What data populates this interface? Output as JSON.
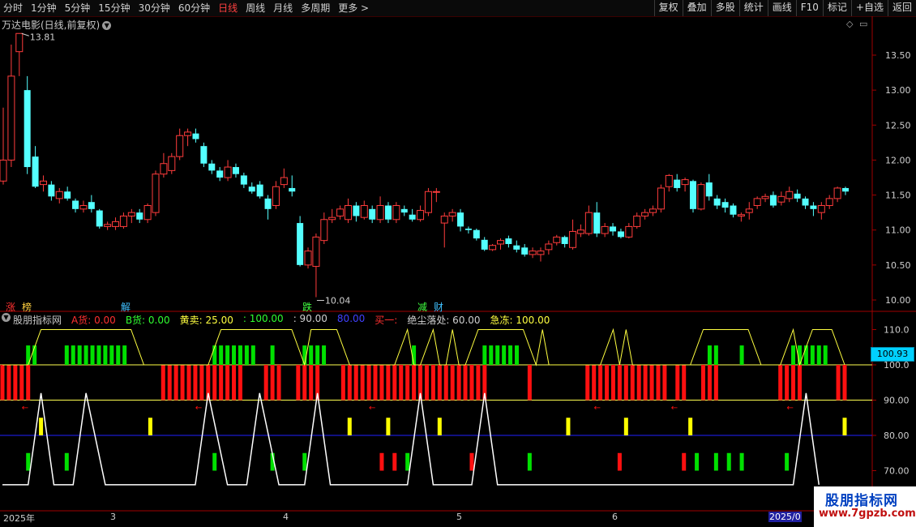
{
  "toolbar": {
    "periods": [
      "分时",
      "1分钟",
      "5分钟",
      "15分钟",
      "30分钟",
      "60分钟",
      "日线",
      "周线",
      "月线",
      "多周期",
      "更多 >"
    ],
    "active_period": "日线",
    "buttons": [
      "复权",
      "叠加",
      "多股",
      "统计",
      "画线",
      "F10",
      "标记",
      "+自选",
      "返回"
    ]
  },
  "stock": {
    "title": "万达电影(日线,前复权)",
    "high_label": "13.81",
    "low_label": "10.04"
  },
  "price_axis": [
    "13.50",
    "13.00",
    "12.50",
    "12.00",
    "11.50",
    "11.00",
    "10.50",
    "10.00"
  ],
  "indicator_axis": [
    "110.0",
    "100.0",
    "90.00",
    "80.00",
    "70.00"
  ],
  "current_value_tag": "100.93",
  "events": [
    {
      "text": "涨",
      "color": "#ff3030"
    },
    {
      "text": "榜",
      "color": "#ffd040"
    },
    {
      "text": "解",
      "color": "#40c0ff"
    },
    {
      "text": "跌",
      "color": "#40ff40"
    },
    {
      "text": "减",
      "color": "#40ff40"
    },
    {
      "text": "财",
      "color": "#40c0ff"
    }
  ],
  "indicator": {
    "name": "股朋指标网",
    "items": [
      {
        "text": "A货: 0.00",
        "color": "#ff3030"
      },
      {
        "text": "B货: 0.00",
        "color": "#30ff30"
      },
      {
        "text": "黄卖: 25.00",
        "color": "#ffff40"
      },
      {
        "text": ": 100.00",
        "color": "#30ff30"
      },
      {
        "text": ": 90.00",
        "color": "#d0d0d0"
      },
      {
        "text": "80.00",
        "color": "#4040ff"
      },
      {
        "text": "买一:",
        "color": "#ff3030"
      },
      {
        "text": "绝尘落处: 60.00",
        "color": "#d0d0d0"
      },
      {
        "text": "急冻: 100.00",
        "color": "#ffff40"
      }
    ]
  },
  "date_axis": [
    "2025年",
    "3",
    "4",
    "5",
    "6",
    "2025/0"
  ],
  "watermark": {
    "name": "股朋指标网",
    "url": "www.7gpzb.com"
  },
  "colors": {
    "up": "#ff3c3c",
    "down": "#54ffff",
    "axis": "#a00000",
    "green_bar": "#00e000",
    "red_bar": "#ff1010",
    "yellow_bar": "#ffff00",
    "line_80": "#2020ff"
  },
  "chart_data": {
    "type": "candlestick",
    "ylim": [
      9.9,
      13.9
    ],
    "candles": [
      [
        11.7,
        12.0,
        11.65,
        12.75
      ],
      [
        12.0,
        13.2,
        11.9,
        13.65
      ],
      [
        13.55,
        13.81,
        13.2,
        13.81
      ],
      [
        13.0,
        11.9,
        11.8,
        13.2
      ],
      [
        12.05,
        11.62,
        11.6,
        12.2
      ],
      [
        11.65,
        11.7,
        11.55,
        11.78
      ],
      [
        11.65,
        11.48,
        11.42,
        11.7
      ],
      [
        11.45,
        11.55,
        11.38,
        11.6
      ],
      [
        11.55,
        11.45,
        11.42,
        11.62
      ],
      [
        11.42,
        11.3,
        11.25,
        11.45
      ],
      [
        11.3,
        11.35,
        11.25,
        11.42
      ],
      [
        11.4,
        11.3,
        11.25,
        11.5
      ],
      [
        11.28,
        11.05,
        11.02,
        11.3
      ],
      [
        11.05,
        11.08,
        11.0,
        11.12
      ],
      [
        11.05,
        11.12,
        11.0,
        11.18
      ],
      [
        11.05,
        11.2,
        11.02,
        11.25
      ],
      [
        11.2,
        11.25,
        11.1,
        11.3
      ],
      [
        11.25,
        11.15,
        11.1,
        11.3
      ],
      [
        11.15,
        11.35,
        11.1,
        11.38
      ],
      [
        11.25,
        11.8,
        11.2,
        11.85
      ],
      [
        11.8,
        11.95,
        11.75,
        12.1
      ],
      [
        11.85,
        12.05,
        11.8,
        12.1
      ],
      [
        12.05,
        12.35,
        12.0,
        12.45
      ],
      [
        12.35,
        12.4,
        12.2,
        12.45
      ],
      [
        12.38,
        12.3,
        12.25,
        12.45
      ],
      [
        12.2,
        11.95,
        11.9,
        12.25
      ],
      [
        11.95,
        11.85,
        11.8,
        12.0
      ],
      [
        11.85,
        11.75,
        11.7,
        11.9
      ],
      [
        11.75,
        11.9,
        11.7,
        12.0
      ],
      [
        11.9,
        11.8,
        11.75,
        11.95
      ],
      [
        11.78,
        11.65,
        11.6,
        11.82
      ],
      [
        11.62,
        11.55,
        11.52,
        11.68
      ],
      [
        11.65,
        11.48,
        11.45,
        11.7
      ],
      [
        11.45,
        11.3,
        11.15,
        11.5
      ],
      [
        11.35,
        11.62,
        11.3,
        11.7
      ],
      [
        11.65,
        11.75,
        11.6,
        11.88
      ],
      [
        11.6,
        11.55,
        11.48,
        11.78
      ],
      [
        11.1,
        10.5,
        10.48,
        11.2
      ],
      [
        10.5,
        10.7,
        10.45,
        10.75
      ],
      [
        10.48,
        10.9,
        10.04,
        10.95
      ],
      [
        10.85,
        11.15,
        10.8,
        11.25
      ],
      [
        11.15,
        11.18,
        11.1,
        11.3
      ],
      [
        11.2,
        11.3,
        11.15,
        11.35
      ],
      [
        11.15,
        11.35,
        11.1,
        11.45
      ],
      [
        11.35,
        11.2,
        11.12,
        11.4
      ],
      [
        11.18,
        11.35,
        11.15,
        11.42
      ],
      [
        11.3,
        11.15,
        11.1,
        11.35
      ],
      [
        11.15,
        11.35,
        11.1,
        11.48
      ],
      [
        11.35,
        11.15,
        11.1,
        11.4
      ],
      [
        11.15,
        11.35,
        11.1,
        11.4
      ],
      [
        11.3,
        11.25,
        11.2,
        11.35
      ],
      [
        11.22,
        11.15,
        11.12,
        11.3
      ],
      [
        11.15,
        11.28,
        11.12,
        11.35
      ],
      [
        11.25,
        11.55,
        11.2,
        11.6
      ],
      [
        11.55,
        11.55,
        11.4,
        11.6
      ],
      [
        11.1,
        11.2,
        10.75,
        11.25
      ],
      [
        11.2,
        11.25,
        11.12,
        11.3
      ],
      [
        11.25,
        11.05,
        10.98,
        11.3
      ],
      [
        11.02,
        11.0,
        10.95,
        11.05
      ],
      [
        11.0,
        10.88,
        10.85,
        11.02
      ],
      [
        10.86,
        10.72,
        10.7,
        10.9
      ],
      [
        10.72,
        10.78,
        10.7,
        10.8
      ],
      [
        10.8,
        10.85,
        10.72,
        10.88
      ],
      [
        10.88,
        10.8,
        10.75,
        10.92
      ],
      [
        10.78,
        10.72,
        10.68,
        10.85
      ],
      [
        10.75,
        10.65,
        10.62,
        10.8
      ],
      [
        10.65,
        10.7,
        10.6,
        10.75
      ],
      [
        10.65,
        10.7,
        10.55,
        10.75
      ],
      [
        10.72,
        10.8,
        10.65,
        10.85
      ],
      [
        10.82,
        10.9,
        10.78,
        10.93
      ],
      [
        10.9,
        10.8,
        10.75,
        10.92
      ],
      [
        10.75,
        10.98,
        10.72,
        11.15
      ],
      [
        10.95,
        11.0,
        10.9,
        11.08
      ],
      [
        10.95,
        11.25,
        10.92,
        11.35
      ],
      [
        11.25,
        10.95,
        10.9,
        11.4
      ],
      [
        10.95,
        11.05,
        10.9,
        11.1
      ],
      [
        11.05,
        10.98,
        10.92,
        11.1
      ],
      [
        10.98,
        10.9,
        10.88,
        11.02
      ],
      [
        10.9,
        11.05,
        10.88,
        11.1
      ],
      [
        11.05,
        11.2,
        11.02,
        11.25
      ],
      [
        11.2,
        11.25,
        11.15,
        11.3
      ],
      [
        11.25,
        11.3,
        11.2,
        11.35
      ],
      [
        11.3,
        11.6,
        11.25,
        11.65
      ],
      [
        11.62,
        11.78,
        11.55,
        11.8
      ],
      [
        11.72,
        11.6,
        11.55,
        11.8
      ],
      [
        11.65,
        11.72,
        11.55,
        11.75
      ],
      [
        11.7,
        11.3,
        11.25,
        11.72
      ],
      [
        11.3,
        11.65,
        11.28,
        11.68
      ],
      [
        11.68,
        11.48,
        11.42,
        11.8
      ],
      [
        11.45,
        11.35,
        11.3,
        11.5
      ],
      [
        11.4,
        11.32,
        11.25,
        11.45
      ],
      [
        11.35,
        11.22,
        11.18,
        11.38
      ],
      [
        11.2,
        11.22,
        11.12,
        11.25
      ],
      [
        11.25,
        11.3,
        11.15,
        11.4
      ],
      [
        11.35,
        11.45,
        11.3,
        11.48
      ],
      [
        11.45,
        11.48,
        11.4,
        11.52
      ],
      [
        11.5,
        11.35,
        11.32,
        11.55
      ],
      [
        11.4,
        11.48,
        11.35,
        11.55
      ],
      [
        11.45,
        11.55,
        11.4,
        11.62
      ],
      [
        11.52,
        11.45,
        11.4,
        11.58
      ],
      [
        11.45,
        11.35,
        11.3,
        11.48
      ],
      [
        11.35,
        11.3,
        11.2,
        11.4
      ],
      [
        11.25,
        11.35,
        11.15,
        11.4
      ],
      [
        11.35,
        11.45,
        11.3,
        11.5
      ],
      [
        11.45,
        11.6,
        11.4,
        11.62
      ],
      [
        11.6,
        11.55,
        11.5,
        11.62
      ]
    ],
    "indicator": {
      "ylim": [
        63,
        113
      ],
      "red_bars": [
        0,
        1,
        2,
        3,
        4,
        25,
        26,
        27,
        28,
        29,
        30,
        31,
        32,
        33,
        34,
        35,
        36,
        37,
        41,
        42,
        43,
        46,
        47,
        48,
        49,
        53,
        54,
        55,
        56,
        57,
        58,
        59,
        60,
        61,
        62,
        63,
        64,
        65,
        66,
        67,
        68,
        69,
        70,
        71,
        72,
        73,
        74,
        75,
        82,
        91,
        92,
        93,
        94,
        95,
        96,
        97,
        98,
        99,
        100,
        101,
        102,
        103,
        105,
        106,
        109,
        110,
        111,
        121,
        122,
        123,
        124,
        130,
        131
      ],
      "green_top_bars": [
        4,
        5,
        10,
        11,
        12,
        13,
        14,
        15,
        16,
        17,
        18,
        19,
        33,
        34,
        35,
        36,
        37,
        38,
        39,
        42,
        47,
        48,
        49,
        50,
        64,
        75,
        76,
        77,
        78,
        79,
        80,
        110,
        111,
        115,
        123,
        124,
        125,
        126,
        127,
        128
      ],
      "yellow_bars": [
        6,
        23,
        54,
        60,
        68,
        88,
        97,
        107,
        131
      ],
      "green_mid_bars": [
        4,
        10,
        33,
        42,
        47,
        63,
        82,
        108,
        111,
        113,
        115,
        122
      ],
      "red_mid_bars": [
        59,
        61,
        73,
        96,
        106
      ],
      "small_arrows": [
        4,
        31,
        58,
        93,
        105,
        123
      ],
      "yellow_line": [
        [
          0,
          100
        ],
        [
          4,
          100
        ],
        [
          6,
          110
        ],
        [
          20,
          110
        ],
        [
          22,
          100
        ],
        [
          32,
          100
        ],
        [
          34,
          110
        ],
        [
          45,
          110
        ],
        [
          47,
          100
        ],
        [
          48,
          110
        ],
        [
          52,
          110
        ],
        [
          54,
          100
        ],
        [
          61,
          100
        ],
        [
          63,
          110
        ],
        [
          64,
          100
        ],
        [
          65,
          100
        ],
        [
          67,
          110
        ],
        [
          68,
          100
        ],
        [
          69,
          100
        ],
        [
          70,
          110
        ],
        [
          71,
          100
        ],
        [
          72,
          100
        ],
        [
          74,
          110
        ],
        [
          81,
          110
        ],
        [
          83,
          100
        ],
        [
          84,
          110
        ],
        [
          85,
          100
        ],
        [
          93,
          100
        ],
        [
          95,
          110
        ],
        [
          96,
          100
        ],
        [
          97,
          110
        ],
        [
          98,
          100
        ],
        [
          107,
          100
        ],
        [
          109,
          110
        ],
        [
          116,
          110
        ],
        [
          118,
          100
        ],
        [
          121,
          100
        ],
        [
          123,
          110
        ],
        [
          124,
          100
        ],
        [
          126,
          110
        ],
        [
          129,
          110
        ],
        [
          131,
          100
        ]
      ],
      "white_line": [
        [
          0,
          66
        ],
        [
          4,
          66
        ],
        [
          6,
          92
        ],
        [
          8,
          66
        ],
        [
          11,
          66
        ],
        [
          13,
          92
        ],
        [
          16,
          66
        ],
        [
          30,
          66
        ],
        [
          32,
          92
        ],
        [
          35,
          66
        ],
        [
          38,
          66
        ],
        [
          40,
          92
        ],
        [
          43,
          66
        ],
        [
          47,
          66
        ],
        [
          49,
          92
        ],
        [
          51,
          66
        ],
        [
          63,
          66
        ],
        [
          65,
          92
        ],
        [
          67,
          66
        ],
        [
          73,
          66
        ],
        [
          75,
          92
        ],
        [
          77,
          66
        ],
        [
          123,
          66
        ],
        [
          125,
          92
        ],
        [
          127,
          66
        ]
      ]
    }
  }
}
